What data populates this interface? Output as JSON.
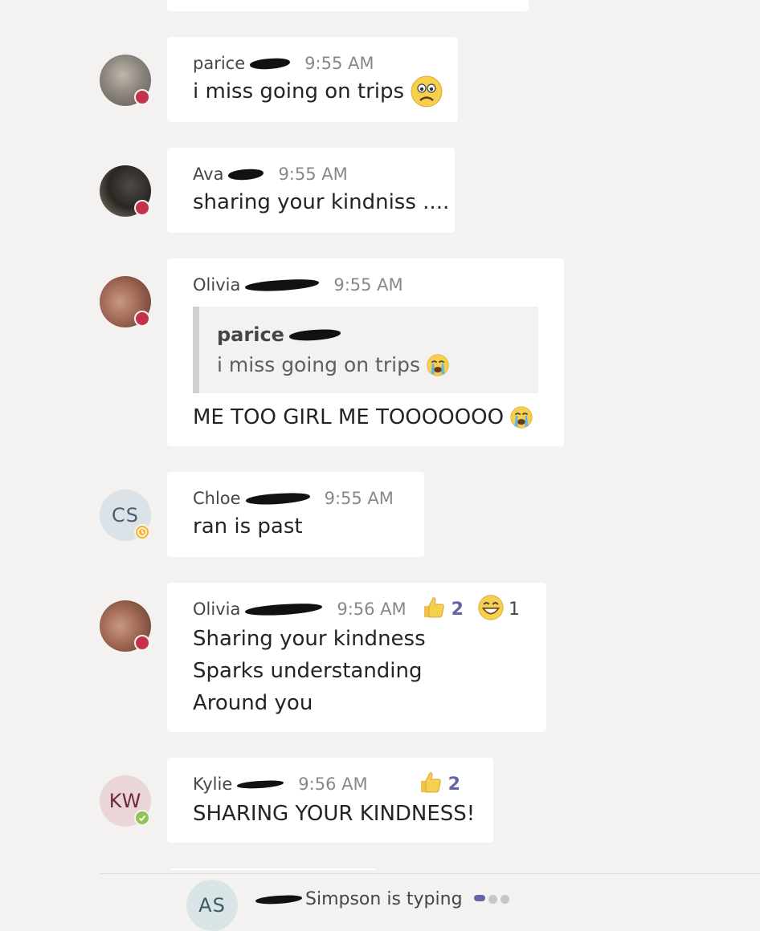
{
  "messages": [
    {
      "author": "parice",
      "time": "9:55 AM",
      "text": "i miss going on trips",
      "status": "busy"
    },
    {
      "author": "Ava",
      "time": "9:55 AM",
      "text": "sharing your kindniss ....",
      "status": "busy"
    },
    {
      "author": "Olivia",
      "time": "9:55 AM",
      "quote": {
        "author": "parice",
        "text": "i miss going on trips"
      },
      "text": "ME TOO GIRL ME TOOOOOOO",
      "status": "busy"
    },
    {
      "author": "Chloe",
      "initials": "CS",
      "time": "9:55 AM",
      "text": "ran is past",
      "status": "away"
    },
    {
      "author": "Olivia",
      "time": "9:56 AM",
      "lines": [
        "Sharing your kindness",
        "Sparks understanding",
        "Around you"
      ],
      "reactions": [
        {
          "icon": "thumbs-up",
          "count": "2"
        },
        {
          "icon": "grinning-face",
          "count": "1"
        }
      ],
      "status": "busy"
    },
    {
      "author": "Kylie",
      "initials": "KW",
      "time": "9:56 AM",
      "text": "SHARING YOUR KINDNESS!",
      "reactions": [
        {
          "icon": "thumbs-up",
          "count": "2"
        }
      ],
      "status": "available"
    }
  ],
  "typing": {
    "initials": "AS",
    "text": "Simpson is typing"
  },
  "colors": {
    "busy": "#c4314b",
    "away": "#f8d22a",
    "available": "#92c353",
    "accent": "#6264a7"
  }
}
